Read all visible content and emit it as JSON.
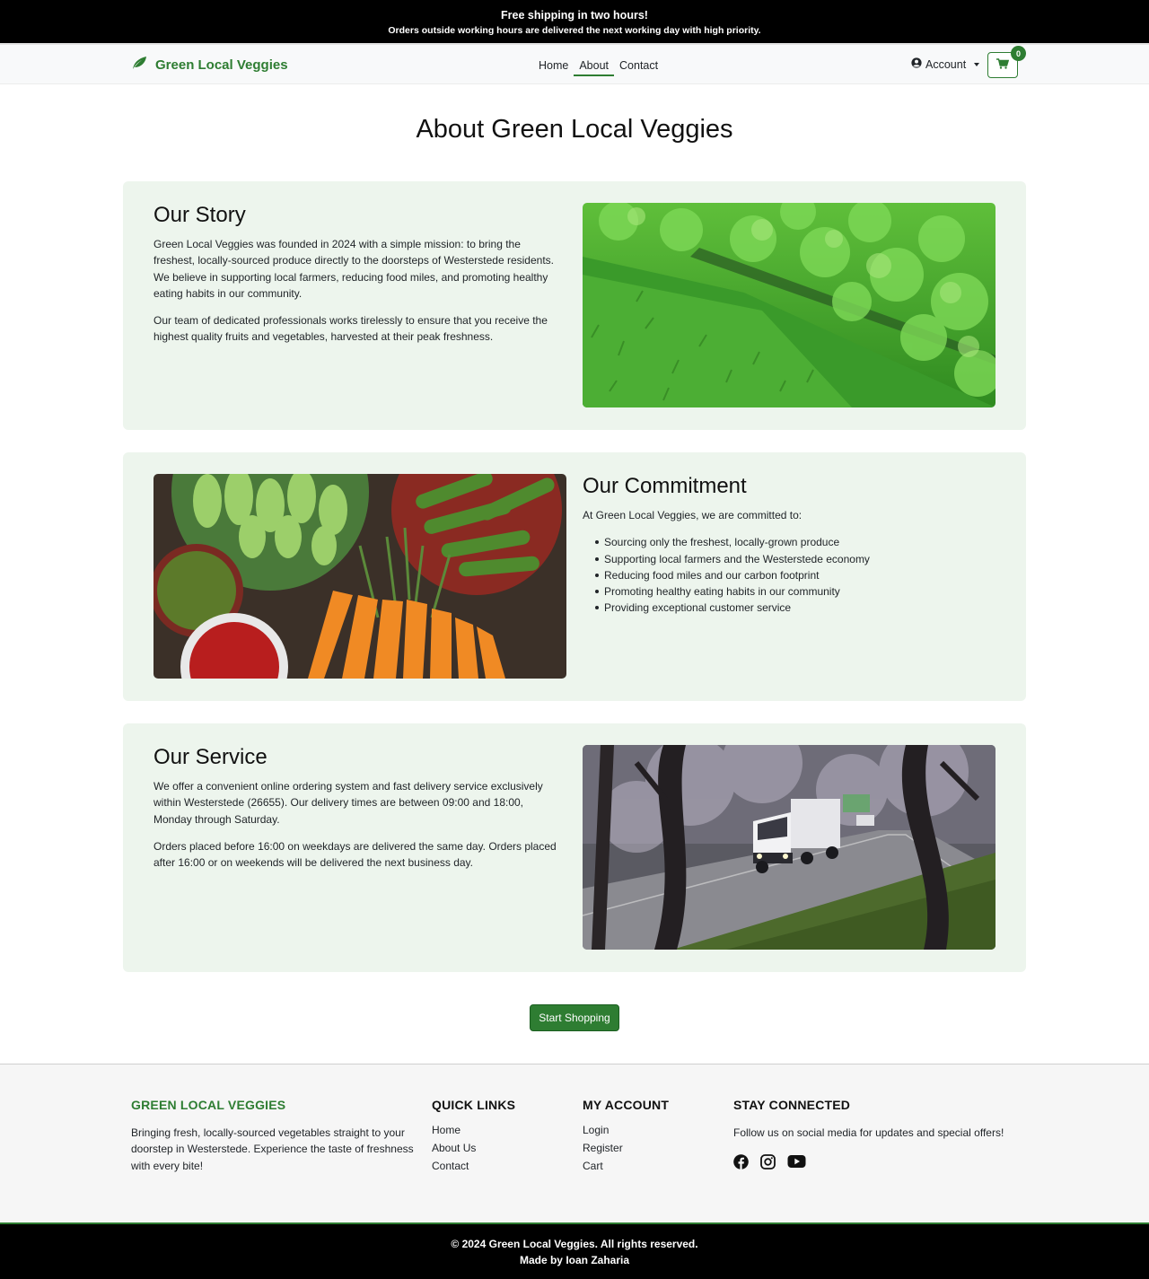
{
  "announcement": {
    "title": "Free shipping in two hours!",
    "subtitle": "Orders outside working hours are delivered the next working day with high priority."
  },
  "navbar": {
    "brand": "Green Local Veggies",
    "links": [
      "Home",
      "About",
      "Contact"
    ],
    "active_link": "About",
    "account_label": "Account",
    "cart_count": "0"
  },
  "page_title": "About Green Local Veggies",
  "story": {
    "heading": "Our Story",
    "paragraphs": [
      "Green Local Veggies was founded in 2024 with a simple mission: to bring the freshest, locally-sourced produce directly to the doorsteps of Westerstede residents. We believe in supporting local farmers, reducing food miles, and promoting healthy eating habits in our community.",
      "Our team of dedicated professionals works tirelessly to ensure that you receive the highest quality fruits and vegetables, harvested at their peak freshness."
    ]
  },
  "commitment": {
    "heading": "Our Commitment",
    "intro": "At Green Local Veggies, we are committed to:",
    "items": [
      "Sourcing only the freshest, locally-grown produce",
      "Supporting local farmers and the Westerstede economy",
      "Reducing food miles and our carbon footprint",
      "Promoting healthy eating habits in our community",
      "Providing exceptional customer service"
    ]
  },
  "service": {
    "heading": "Our Service",
    "paragraphs": [
      "We offer a convenient online ordering system and fast delivery service exclusively within Westerstede (26655). Our delivery times are between 09:00 and 18:00, Monday through Saturday.",
      "Orders placed before 16:00 on weekdays are delivered the same day. Orders placed after 16:00 or on weekends will be delivered the next business day."
    ]
  },
  "cta_label": "Start Shopping",
  "footer": {
    "brand_heading": "GREEN LOCAL VEGGIES",
    "brand_text": "Bringing fresh, locally-sourced vegetables straight to your doorstep in Westerstede. Experience the taste of freshness with every bite!",
    "quick_links_heading": "QUICK LINKS",
    "quick_links": [
      "Home",
      "About Us",
      "Contact"
    ],
    "account_heading": "MY ACCOUNT",
    "account_links": [
      "Login",
      "Register",
      "Cart"
    ],
    "social_heading": "STAY CONNECTED",
    "social_text": "Follow us on social media for updates and special offers!",
    "social_icons": [
      "facebook-icon",
      "instagram-icon",
      "youtube-icon"
    ],
    "copyright": "© 2024 Green Local Veggies. All rights reserved.",
    "credit": "Made by Ioan Zaharia"
  },
  "colors": {
    "brand_green": "#2e7d32",
    "card_background": "#edf5ed",
    "bar_black": "#000000"
  }
}
